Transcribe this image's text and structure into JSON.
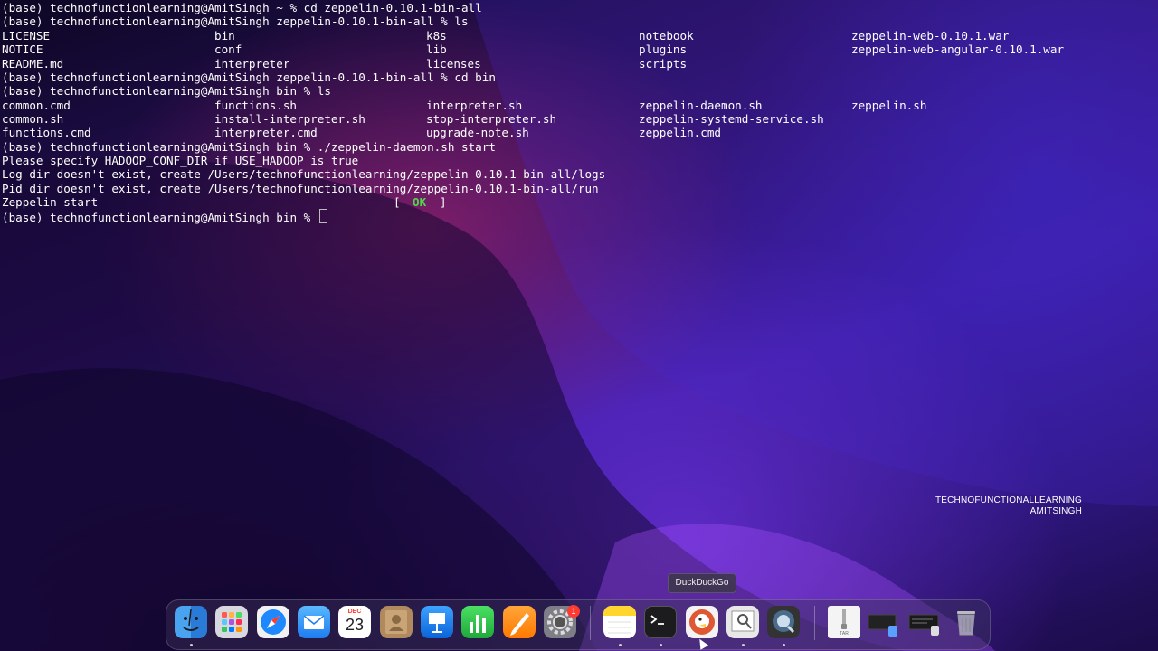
{
  "terminal": {
    "lines": [
      "(base) technofunctionlearning@AmitSingh ~ % cd zeppelin-0.10.1-bin-all",
      "(base) technofunctionlearning@AmitSingh zeppelin-0.10.1-bin-all % ls",
      "(base) technofunctionlearning@AmitSingh zeppelin-0.10.1-bin-all % cd bin",
      "(base) technofunctionlearning@AmitSingh bin % ls",
      "(base) technofunctionlearning@AmitSingh bin % ./zeppelin-daemon.sh start",
      "Please specify HADOOP_CONF_DIR if USE_HADOOP is true",
      "Log dir doesn't exist, create /Users/technofunctionlearning/zeppelin-0.10.1-bin-all/logs",
      "Pid dir doesn't exist, create /Users/technofunctionlearning/zeppelin-0.10.1-bin-all/run",
      "Zeppelin start",
      "(base) technofunctionlearning@AmitSingh bin % "
    ],
    "ls1": [
      [
        "LICENSE",
        "bin",
        "k8s",
        "notebook",
        "zeppelin-web-0.10.1.war"
      ],
      [
        "NOTICE",
        "conf",
        "lib",
        "plugins",
        "zeppelin-web-angular-0.10.1.war"
      ],
      [
        "README.md",
        "interpreter",
        "licenses",
        "scripts",
        ""
      ]
    ],
    "ls2": [
      [
        "common.cmd",
        "functions.sh",
        "interpreter.sh",
        "zeppelin-daemon.sh",
        "zeppelin.sh"
      ],
      [
        "common.sh",
        "install-interpreter.sh",
        "stop-interpreter.sh",
        "zeppelin-systemd-service.sh",
        ""
      ],
      [
        "functions.cmd",
        "interpreter.cmd",
        "upgrade-note.sh",
        "zeppelin.cmd",
        ""
      ]
    ],
    "status_open": "[",
    "status_ok": "OK",
    "status_close": "]"
  },
  "watermark": {
    "line1": "TECHNOFUNCTIONALLEARNING",
    "line2": "AMITSINGH"
  },
  "tooltip": "DuckDuckGo",
  "dock": {
    "calendar_month": "DEC",
    "calendar_day": "23",
    "settings_badge": "1",
    "archive_label": "TAR",
    "items": [
      "finder-icon",
      "launchpad-icon",
      "safari-icon",
      "mail-icon",
      "calendar-icon",
      "contacts-icon",
      "keynote-icon",
      "numbers-icon",
      "pages-icon",
      "system-preferences-icon",
      "notes-icon",
      "terminal-icon",
      "duckduckgo-icon",
      "preview-icon",
      "quicktime-icon",
      "archive-icon",
      "window-thumbnail-icon",
      "window-thumbnail-icon",
      "trash-icon"
    ]
  },
  "colors": {
    "ok": "#4bd84b",
    "text": "#ffffff"
  }
}
